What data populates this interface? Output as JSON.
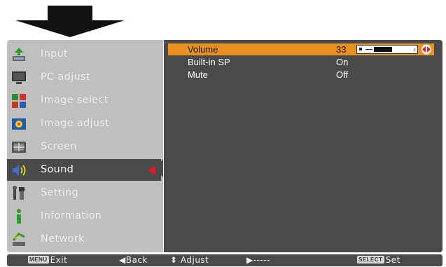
{
  "menu": {
    "items": [
      {
        "label": "Input",
        "icon": "input-icon"
      },
      {
        "label": "PC adjust",
        "icon": "pc-adjust-icon"
      },
      {
        "label": "Image select",
        "icon": "image-select-icon"
      },
      {
        "label": "Image adjust",
        "icon": "image-adjust-icon"
      },
      {
        "label": "Screen",
        "icon": "screen-icon"
      },
      {
        "label": "Sound",
        "icon": "sound-icon"
      },
      {
        "label": "Setting",
        "icon": "setting-icon"
      },
      {
        "label": "Information",
        "icon": "information-icon"
      },
      {
        "label": "Network",
        "icon": "network-icon"
      }
    ],
    "active_label": "Sound"
  },
  "content": {
    "rows": [
      {
        "label": "Volume",
        "value": "33"
      },
      {
        "label": "Built-in SP",
        "value": "On"
      },
      {
        "label": "Mute",
        "value": "Off"
      }
    ],
    "volume_level_fraction": 0.52
  },
  "bottom_bar": {
    "exit_key": "MENU",
    "exit_label": "Exit",
    "back_label": "◀Back",
    "adjust_label": "⬍ Adjust",
    "forward_label": "▶-----",
    "set_key": "SELECT",
    "set_label": "Set"
  },
  "colors": {
    "highlight": "#e8901f",
    "active_marker": "#e11c24",
    "panel_dark": "#4a4a4a",
    "panel_light": "#bfbfbd"
  }
}
